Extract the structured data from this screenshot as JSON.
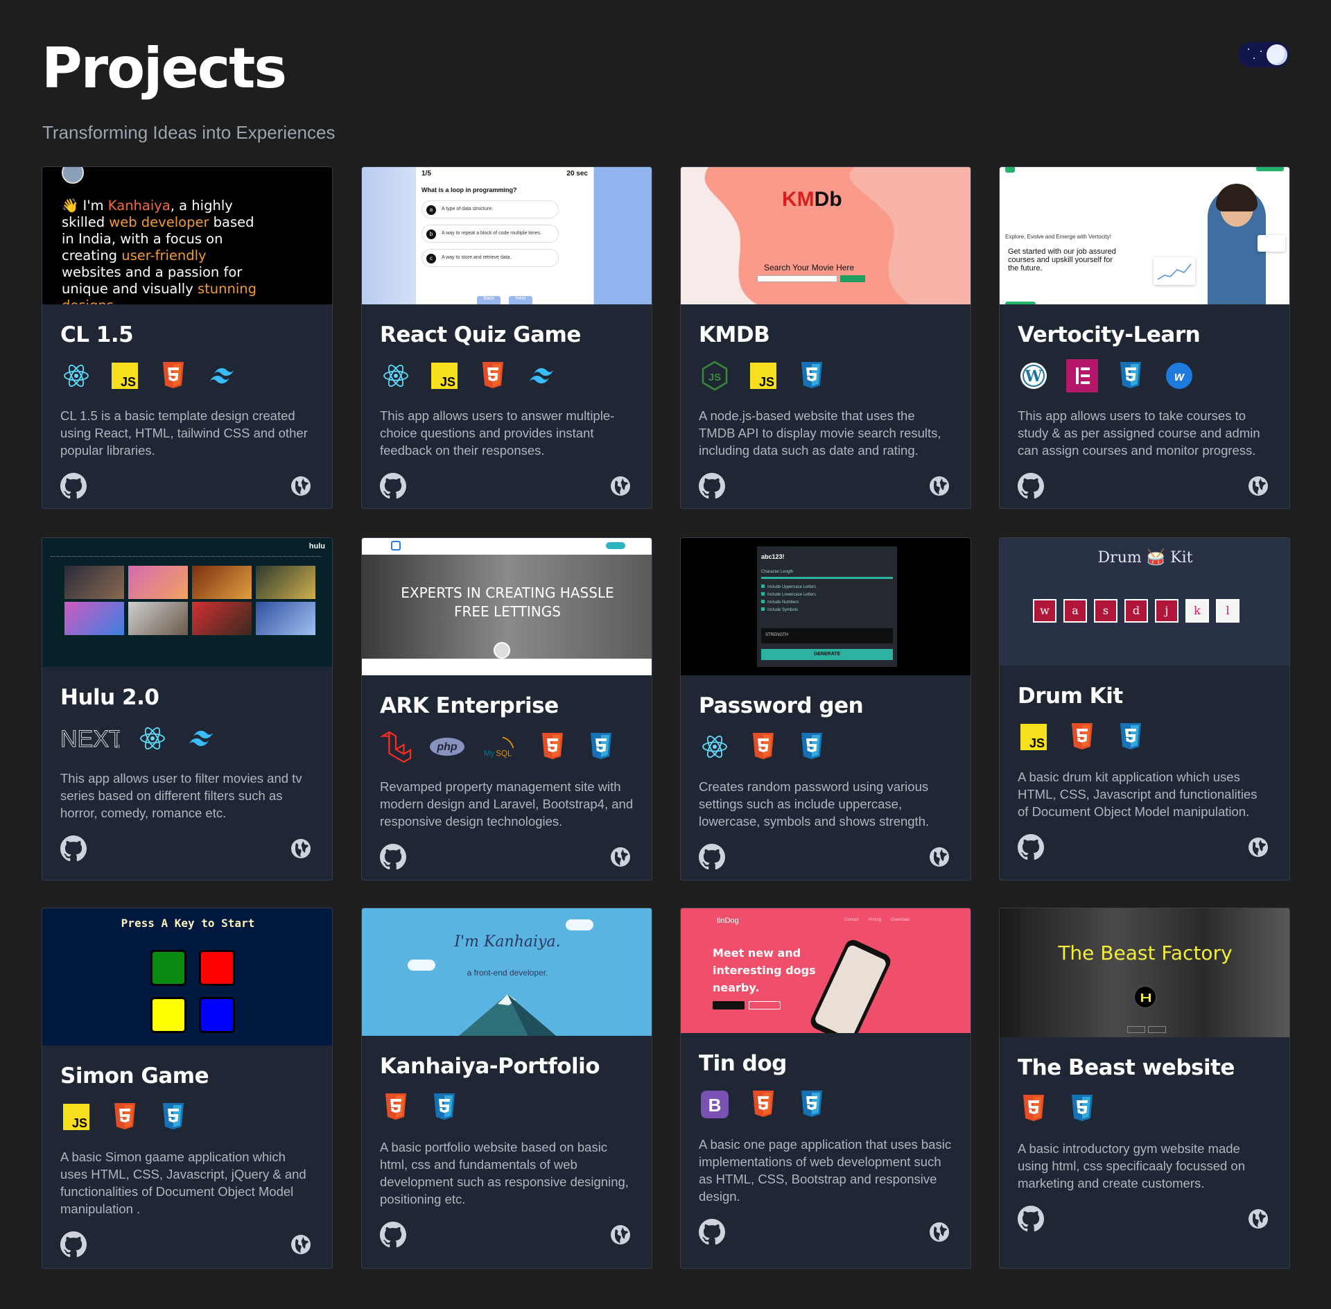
{
  "header": {
    "title": "Projects",
    "subtitle": "Transforming Ideas into Experiences",
    "theme_toggle": "dark-mode-toggle"
  },
  "thumbs": {
    "cl": {
      "line1_pre": "👋 I'm ",
      "line1_name": "Kanhaiya",
      "line1_post": ", a highly",
      "line2_pre": "skilled ",
      "line2_hl": "web developer",
      "line2_post": " based",
      "line3": "in India, with a focus on",
      "line4_pre": "creating ",
      "line4_hl": "user-friendly",
      "line5": "websites and a passion for",
      "line6_pre": "unique and visually ",
      "line6_hl": "stunning",
      "line7": "designs"
    },
    "quiz": {
      "counter": "1/5",
      "timer": "20 sec",
      "question": "What is a loop in programming?",
      "options": [
        {
          "key": "a",
          "text": "A type of data structure."
        },
        {
          "key": "b",
          "text": "A way to repeat a block of code multiple times."
        },
        {
          "key": "c",
          "text": "A way to store and retrieve data."
        }
      ],
      "back": "Back",
      "next": "Next"
    },
    "kmdb": {
      "logo_a": "KM",
      "logo_b": "Db",
      "search_label": "Search Your Movie Here"
    },
    "vert": {
      "tagline": "Explore, Evolve and Emerge with Vertocity!",
      "heading": "Get started with our job assured courses and upskill yourself for the future."
    },
    "hulu": {
      "logo": "hulu"
    },
    "ark": {
      "headline1": "EXPERTS IN CREATING HASSLE",
      "headline2": "FREE LETTINGS"
    },
    "pass": {
      "password": "abc123!",
      "length_label": "Character Length",
      "options": [
        "Include Uppercase Letters",
        "Include Lowercase Letters",
        "Include Numbers",
        "Include Symbols"
      ],
      "strength": "STRENGTH",
      "generate": "GENERATE"
    },
    "drum": {
      "title_a": "Drum",
      "title_b": "Kit",
      "keys": [
        "w",
        "a",
        "s",
        "d",
        "j",
        "k",
        "l"
      ]
    },
    "simon": {
      "prompt": "Press A Key to Start"
    },
    "kport": {
      "name": "I'm Kanhaiya.",
      "tagline": "a front-end developer."
    },
    "tin": {
      "brand": "tinDog",
      "nav": [
        "Contact",
        "Pricing",
        "Download"
      ],
      "headline": [
        "Meet new and",
        "interesting dogs",
        "nearby."
      ]
    },
    "beast": {
      "title": "The Beast Factory"
    }
  },
  "projects": [
    {
      "title": "CL 1.5",
      "techs": [
        "react-icon",
        "javascript-icon",
        "html5-icon",
        "tailwind-icon"
      ],
      "description": "CL 1.5 is a basic template design created using React, HTML, tailwind CSS and other popular libraries."
    },
    {
      "title": "React Quiz Game",
      "techs": [
        "react-icon",
        "javascript-icon",
        "html5-icon",
        "tailwind-icon"
      ],
      "description": "This app allows users to answer multiple-choice questions and provides instant feedback on their responses."
    },
    {
      "title": "KMDB",
      "techs": [
        "nodejs-icon",
        "javascript-icon",
        "css3-icon"
      ],
      "description": "A node.js-based website that uses the TMDB API to display movie search results, including data such as date and rating."
    },
    {
      "title": "Vertocity-Learn",
      "techs": [
        "wordpress-icon",
        "elementor-icon",
        "css3-icon",
        "wix-icon"
      ],
      "description": "This app allows users to take courses to study & as per assigned course and admin can assign courses and monitor progress."
    },
    {
      "title": "Hulu 2.0",
      "techs": [
        "nextjs-icon",
        "react-icon",
        "tailwind-icon"
      ],
      "description": "This app allows user to filter movies and tv series based on different filters such as horror, comedy, romance etc."
    },
    {
      "title": "ARK Enterprise",
      "techs": [
        "laravel-icon",
        "php-icon",
        "mysql-icon",
        "html5-icon",
        "css3-icon"
      ],
      "description": "Revamped property management site with modern design and Laravel, Bootstrap4, and responsive design technologies."
    },
    {
      "title": "Password gen",
      "techs": [
        "react-icon",
        "html5-icon",
        "css3-icon"
      ],
      "description": "Creates random password using various settings such as include uppercase, lowercase, symbols and shows strength."
    },
    {
      "title": "Drum Kit",
      "techs": [
        "javascript-icon",
        "html5-icon",
        "css3-icon"
      ],
      "description": "A basic drum kit application which uses HTML, CSS, Javascript and functionalities of Document Object Model manipulation."
    },
    {
      "title": "Simon Game",
      "techs": [
        "javascript-icon",
        "html5-icon",
        "css3-icon"
      ],
      "description": "A basic Simon gaame application which uses HTML, CSS, Javascript, jQuery & and functionalities of Document Object Model manipulation ."
    },
    {
      "title": "Kanhaiya-Portfolio",
      "techs": [
        "html5-icon",
        "css3-icon"
      ],
      "description": "A basic portfolio website based on basic html, css and fundamentals of web development such as responsive designing, positioning etc."
    },
    {
      "title": "Tin dog",
      "techs": [
        "bootstrap-icon",
        "html5-icon",
        "css3-icon"
      ],
      "description": "A basic one page application that uses basic implementations of web development such as HTML, CSS, Bootstrap and responsive design."
    },
    {
      "title": "The Beast website",
      "techs": [
        "html5-icon",
        "css3-icon"
      ],
      "description": "A basic introductory gym website made using html, css specificaaly focussed on marketing and create customers."
    }
  ],
  "colors": {
    "background": "#1e1e1f",
    "card": "#1f2735",
    "text_muted": "#aeb6c2",
    "accent_orange": "#f5a031"
  }
}
